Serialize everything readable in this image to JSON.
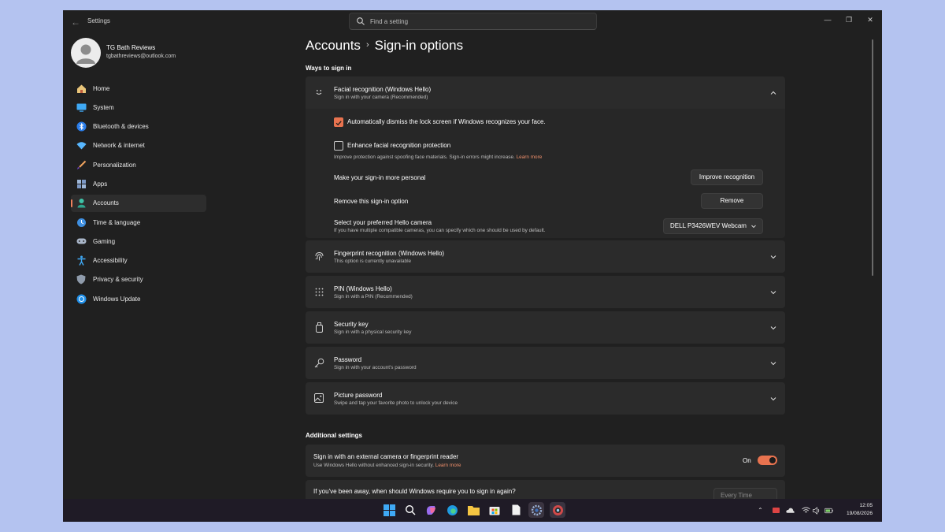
{
  "window": {
    "app_title": "Settings"
  },
  "search": {
    "placeholder": "Find a setting"
  },
  "profile": {
    "name": "TG Bath Reviews",
    "email": "tgbathreviews@outlook.com"
  },
  "nav": {
    "items": [
      {
        "label": "Home",
        "icon": "home-icon"
      },
      {
        "label": "System",
        "icon": "system-icon"
      },
      {
        "label": "Bluetooth & devices",
        "icon": "bluetooth-icon"
      },
      {
        "label": "Network & internet",
        "icon": "wifi-icon"
      },
      {
        "label": "Personalization",
        "icon": "brush-icon"
      },
      {
        "label": "Apps",
        "icon": "apps-icon"
      },
      {
        "label": "Accounts",
        "icon": "person-icon",
        "active": true
      },
      {
        "label": "Time & language",
        "icon": "globe-clock-icon"
      },
      {
        "label": "Gaming",
        "icon": "gamepad-icon"
      },
      {
        "label": "Accessibility",
        "icon": "accessibility-icon"
      },
      {
        "label": "Privacy & security",
        "icon": "shield-icon"
      },
      {
        "label": "Windows Update",
        "icon": "update-icon"
      }
    ]
  },
  "header": {
    "breadcrumb_parent": "Accounts",
    "breadcrumb_current": "Sign-in options"
  },
  "ways_section": {
    "label": "Ways to sign in",
    "facial": {
      "title": "Facial recognition (Windows Hello)",
      "subtitle": "Sign in with your camera (Recommended)",
      "auto_dismiss_label": "Automatically dismiss the lock screen if Windows recognizes your face.",
      "auto_dismiss_checked": true,
      "enhance_label": "Enhance facial recognition protection",
      "enhance_checked": false,
      "enhance_desc": "Improve protection against spoofing face materials. Sign-in errors might increase.",
      "learn_more": "Learn more",
      "personal_label": "Make your sign-in more personal",
      "improve_button": "Improve recognition",
      "remove_label": "Remove this sign-in option",
      "remove_button": "Remove",
      "camera_label": "Select your preferred Hello camera",
      "camera_desc": "If you have multiple compatible cameras, you can specify which one should be used by default.",
      "camera_value": "DELL P3426WEV Webcam"
    },
    "fingerprint": {
      "title": "Fingerprint recognition (Windows Hello)",
      "subtitle": "This option is currently unavailable"
    },
    "pin": {
      "title": "PIN (Windows Hello)",
      "subtitle": "Sign in with a PIN (Recommended)"
    },
    "security_key": {
      "title": "Security key",
      "subtitle": "Sign in with a physical security key"
    },
    "password": {
      "title": "Password",
      "subtitle": "Sign in with your account's password"
    },
    "picture_password": {
      "title": "Picture password",
      "subtitle": "Swipe and tap your favorite photo to unlock your device"
    }
  },
  "additional_section": {
    "label": "Additional settings",
    "external_camera": {
      "title": "Sign in with an external camera or fingerprint reader",
      "subtitle": "Use Windows Hello without enhanced sign-in security.",
      "learn_more": "Learn more",
      "state_label": "On",
      "enabled": true
    },
    "away": {
      "title": "If you've been away, when should Windows require you to sign in again?",
      "value": "Every Time"
    }
  },
  "taskbar": {
    "time": "12:05",
    "date": "19/08/2026",
    "apps": [
      "windows-start-icon",
      "search-icon",
      "copilot-icon",
      "edge-icon",
      "file-explorer-icon",
      "store-icon",
      "notepad-icon",
      "settings-icon",
      "camera-app-icon"
    ]
  },
  "colors": {
    "accent": "#e8734f",
    "link": "#f0906c",
    "background": "#202020",
    "card": "#2b2b2b"
  }
}
